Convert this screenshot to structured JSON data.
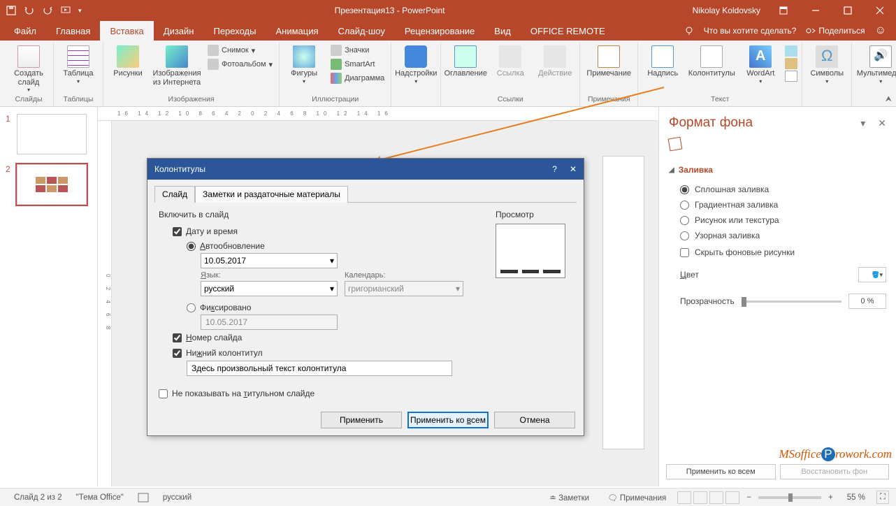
{
  "titlebar": {
    "title": "Презентация13 - PowerPoint",
    "user": "Nikolay Koldovsky"
  },
  "tabs": {
    "file": "Файл",
    "home": "Главная",
    "insert": "Вставка",
    "design": "Дизайн",
    "transitions": "Переходы",
    "animation": "Анимация",
    "slideshow": "Слайд-шоу",
    "review": "Рецензирование",
    "view": "Вид",
    "office_remote": "OFFICE REMOTE",
    "tell_me": "Что вы хотите сделать?",
    "sign_in": "",
    "share": "Поделиться"
  },
  "ribbon": {
    "groups": {
      "slides": {
        "label": "Слайды",
        "new_slide": "Создать слайд"
      },
      "tables": {
        "label": "Таблицы",
        "table": "Таблица"
      },
      "images": {
        "label": "Изображения",
        "pictures": "Рисунки",
        "online_pics": "Изображения из Интернета",
        "screenshot": "Снимок",
        "photo_album": "Фотоальбом"
      },
      "illustrations": {
        "label": "Иллюстрации",
        "shapes": "Фигуры",
        "icons": "Значки",
        "smartart": "SmartArt",
        "chart": "Диаграмма"
      },
      "addins": {
        "label": "",
        "addins": "Надстройки"
      },
      "links": {
        "label": "Ссылки",
        "toc": "Оглавление",
        "link": "Ссылка",
        "action": "Действие"
      },
      "comments": {
        "label": "Примечания",
        "comment": "Примечание"
      },
      "text": {
        "label": "Текст",
        "textbox": "Надпись",
        "header_footer": "Колонтитулы",
        "wordart": "WordArt"
      },
      "symbols": {
        "label": "",
        "symbols": "Символы"
      },
      "media": {
        "label": "",
        "media": "Мультимедиа"
      }
    }
  },
  "dialog": {
    "title": "Колонтитулы",
    "tab_slide": "Слайд",
    "tab_notes": "Заметки и раздаточные материалы",
    "include_label": "Включить в слайд",
    "date_time": "Дату и время",
    "auto_update": "Автообновление",
    "date_value": "10.05.2017",
    "language_label": "Язык:",
    "language_value": "русский",
    "calendar_label": "Календарь:",
    "calendar_value": "григорианский",
    "fixed": "Фиксировано",
    "fixed_value": "10.05.2017",
    "slide_number": "Номер слайда",
    "footer": "Нижний колонтитул",
    "footer_text": "Здесь произвольный текст колонтитула",
    "dont_show_title": "Не показывать на титульном слайде",
    "preview": "Просмотр",
    "apply": "Применить",
    "apply_all": "Применить ко всем",
    "cancel": "Отмена"
  },
  "format_pane": {
    "title": "Формат фона",
    "section": "Заливка",
    "solid": "Сплошная заливка",
    "gradient": "Градиентная заливка",
    "picture": "Рисунок или текстура",
    "pattern": "Узорная заливка",
    "hide_bg": "Скрыть фоновые рисунки",
    "color": "Цвет",
    "transparency": "Прозрачность",
    "transparency_val": "0 %",
    "apply_all": "Применить ко всем",
    "reset": "Восстановить фон"
  },
  "status": {
    "slide_count": "Слайд 2 из 2",
    "theme": "\"Тема Office\"",
    "lang": "русский",
    "notes": "Заметки",
    "comments": "Примечания",
    "zoom": "55 %"
  },
  "thumbnails": {
    "n1": "1",
    "n2": "2"
  },
  "ruler": {
    "h": "16 14 12 10 8 6 4 2 0 2 4 6 8 10 12 14 16",
    "v": "0 2 4 6 8"
  },
  "watermark": "MSofficeProwork.com"
}
